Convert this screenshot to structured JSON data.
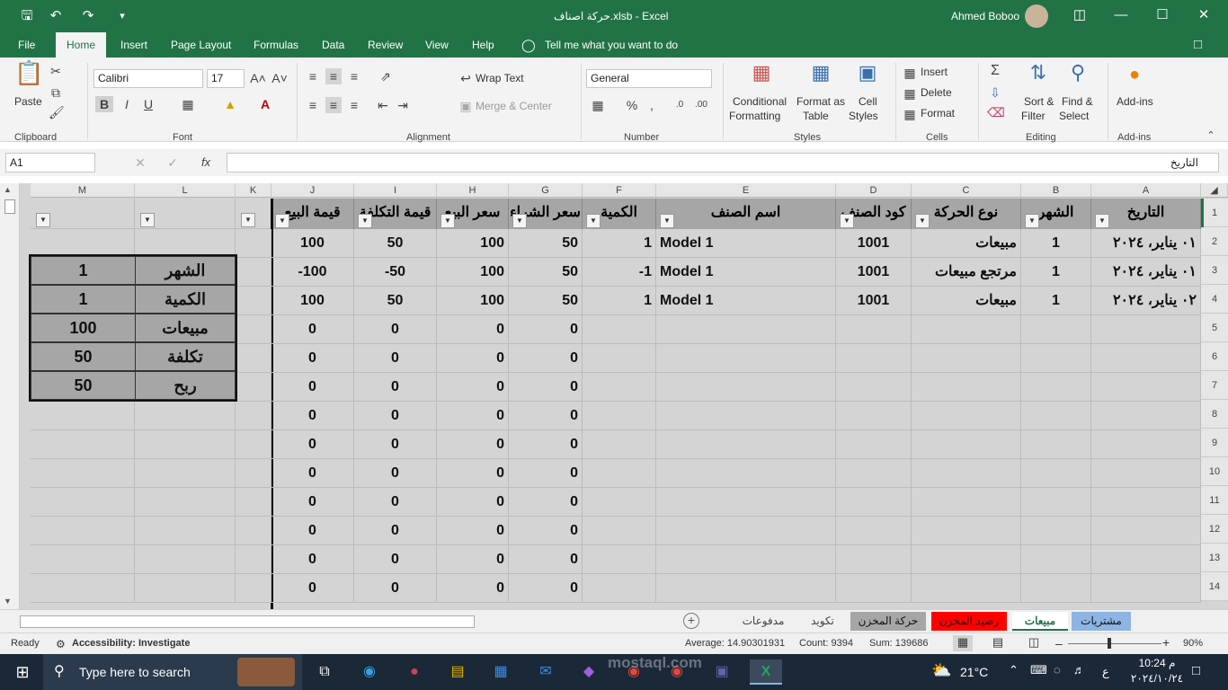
{
  "window": {
    "title": "حركة اصناف.xlsb  -  Excel",
    "user": "Ahmed Boboo"
  },
  "menu": {
    "tabs": [
      "File",
      "Home",
      "Insert",
      "Page Layout",
      "Formulas",
      "Data",
      "Review",
      "View",
      "Help"
    ],
    "tell_me": "Tell me what you want to do"
  },
  "ribbon": {
    "clipboard": {
      "paste": "Paste",
      "group": "Clipboard"
    },
    "font": {
      "name": "Calibri",
      "size": "17",
      "bold": "B",
      "italic": "I",
      "underline": "U",
      "group": "Font"
    },
    "alignment": {
      "wrap": "Wrap Text",
      "merge": "Merge & Center",
      "group": "Alignment"
    },
    "number": {
      "format": "General",
      "group": "Number"
    },
    "styles": {
      "cond1": "Conditional",
      "cond2": "Formatting",
      "fmt1": "Format as",
      "fmt2": "Table",
      "cell1": "Cell",
      "cell2": "Styles",
      "group": "Styles"
    },
    "cells": {
      "insert": "Insert",
      "delete": "Delete",
      "format": "Format",
      "group": "Cells"
    },
    "editing": {
      "sort1": "Sort &",
      "sort2": "Filter",
      "find1": "Find &",
      "find2": "Select",
      "group": "Editing"
    },
    "addins": {
      "label": "Add-ins",
      "group": "Add-ins"
    }
  },
  "formula_bar": {
    "name_box": "A1",
    "cancel": "✕",
    "enter": "✓",
    "fx": "fx",
    "content": "التاريخ"
  },
  "columns": [
    "A",
    "B",
    "C",
    "D",
    "E",
    "F",
    "G",
    "H",
    "I",
    "J",
    "K",
    "L",
    "M"
  ],
  "rows": [
    "1",
    "2",
    "3",
    "4",
    "5",
    "6",
    "7",
    "8",
    "9",
    "10",
    "11",
    "12",
    "13",
    "14"
  ],
  "headers": [
    "التاريخ",
    "الشهر",
    "نوع الحركة",
    "كود الصنف",
    "اسم الصنف",
    "الكمية",
    "سعر الشراء",
    "سعر البيع",
    "قيمة التكلفة",
    "قيمة البيع"
  ],
  "data_rows": [
    {
      "A": "٠١ يناير، ٢٠٢٤",
      "B": "1",
      "C": "مبيعات",
      "D": "1001",
      "E": "Model 1",
      "F": "1",
      "G": "50",
      "H": "100",
      "I": "50",
      "J": "100"
    },
    {
      "A": "٠١ يناير، ٢٠٢٤",
      "B": "1",
      "C": "مرتجع مبيعات",
      "D": "1001",
      "E": "Model 1",
      "F": "-1",
      "G": "50",
      "H": "100",
      "I": "-50",
      "J": "-100"
    },
    {
      "A": "٠٢ يناير، ٢٠٢٤",
      "B": "1",
      "C": "مبيعات",
      "D": "1001",
      "E": "Model 1",
      "F": "1",
      "G": "50",
      "H": "100",
      "I": "50",
      "J": "100"
    }
  ],
  "zero_value": "0",
  "summary": [
    {
      "label": "الشهر",
      "value": "1"
    },
    {
      "label": "الكمية",
      "value": "1"
    },
    {
      "label": "مبيعات",
      "value": "100"
    },
    {
      "label": "تكلفة",
      "value": "50"
    },
    {
      "label": "ربح",
      "value": "50"
    }
  ],
  "sheet_tabs": [
    "مشتريات",
    "مبيعات",
    "رصيد المخزن",
    "حركة المخزن",
    "تكويد",
    "مدفوعات"
  ],
  "status": {
    "ready": "Ready",
    "accessibility": "Accessibility: Investigate",
    "average": "Average: 14.90301931",
    "count": "Count: 9394",
    "sum": "Sum: 139686",
    "zoom": "90%"
  },
  "taskbar": {
    "search": "Type here to search",
    "temp": "21°C",
    "time": "10:24 م",
    "date": "٢٠٢٤/١٠/٢٤",
    "lang": "ع"
  },
  "watermark": {
    "text": "mostaql.com"
  },
  "colors": {
    "excel_green": "#217346",
    "header_gray": "#a6a6a6",
    "tab_blue": "#8db4e2",
    "tab_red": "#ff0000"
  }
}
